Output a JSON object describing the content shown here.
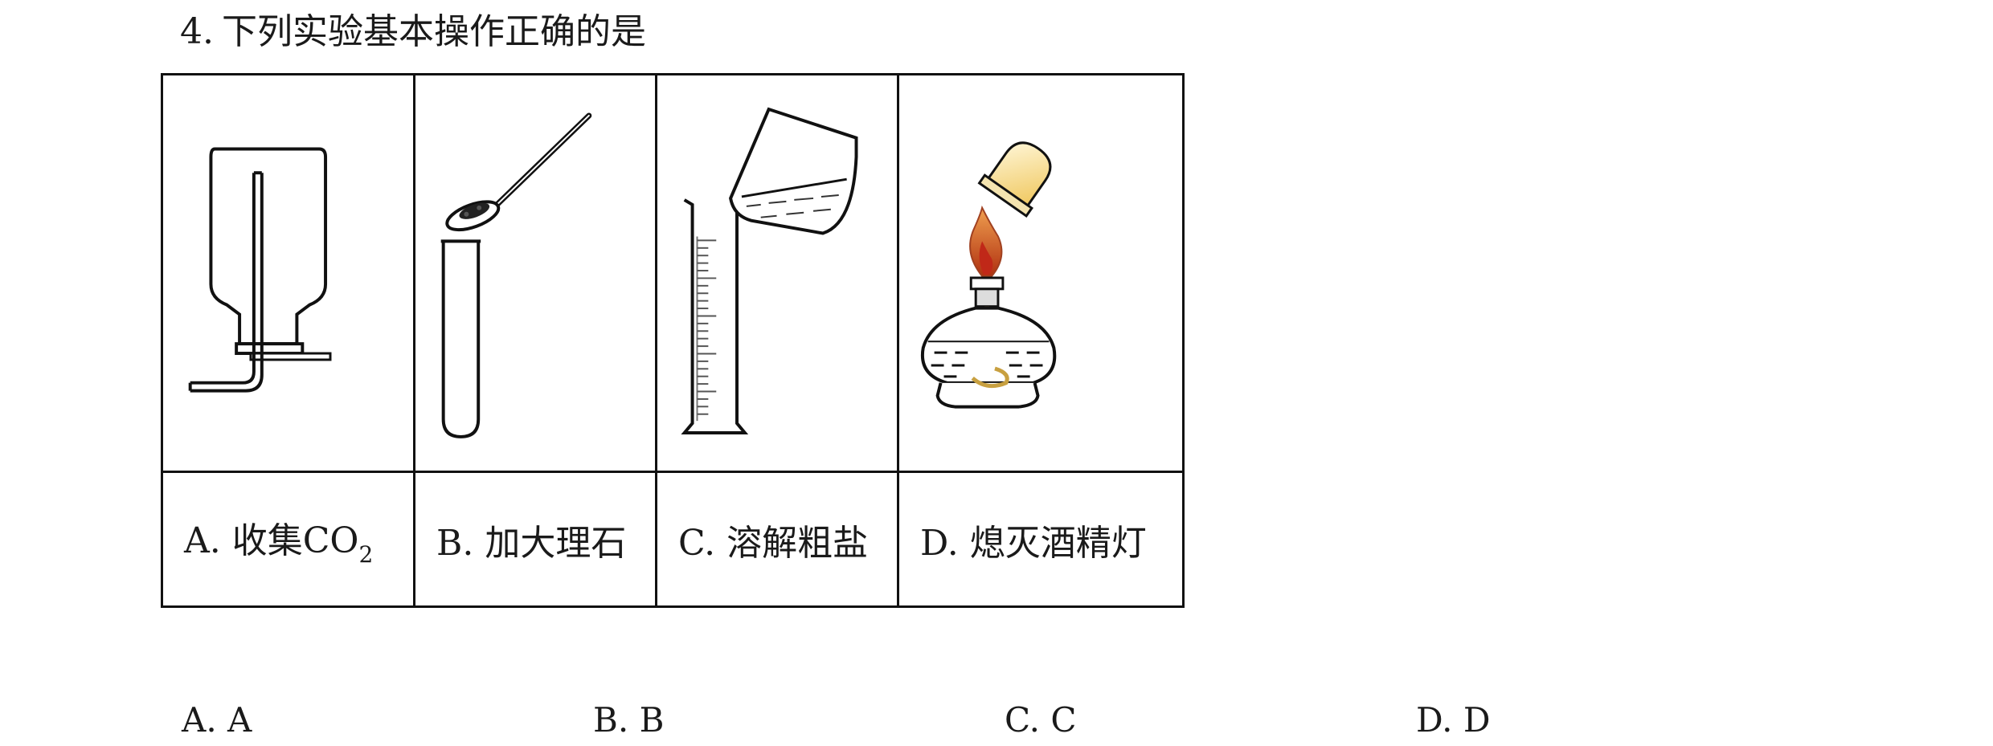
{
  "question": {
    "number": "4.",
    "text": "下列实验基本操作正确的是"
  },
  "options": [
    {
      "letter": "A.",
      "text": "收集",
      "formula": "CO",
      "subscript": "2",
      "icon": "gas-collection-bottle-icon"
    },
    {
      "letter": "B.",
      "text": "加大理石",
      "icon": "spoon-test-tube-icon"
    },
    {
      "letter": "C.",
      "text": "溶解粗盐",
      "icon": "graduated-cylinder-pouring-icon"
    },
    {
      "letter": "D.",
      "text": "熄灭酒精灯",
      "icon": "alcohol-lamp-icon"
    }
  ],
  "answers": [
    {
      "label": "A. A"
    },
    {
      "label": "B. B"
    },
    {
      "label": "C. C"
    },
    {
      "label": "D. D"
    }
  ]
}
